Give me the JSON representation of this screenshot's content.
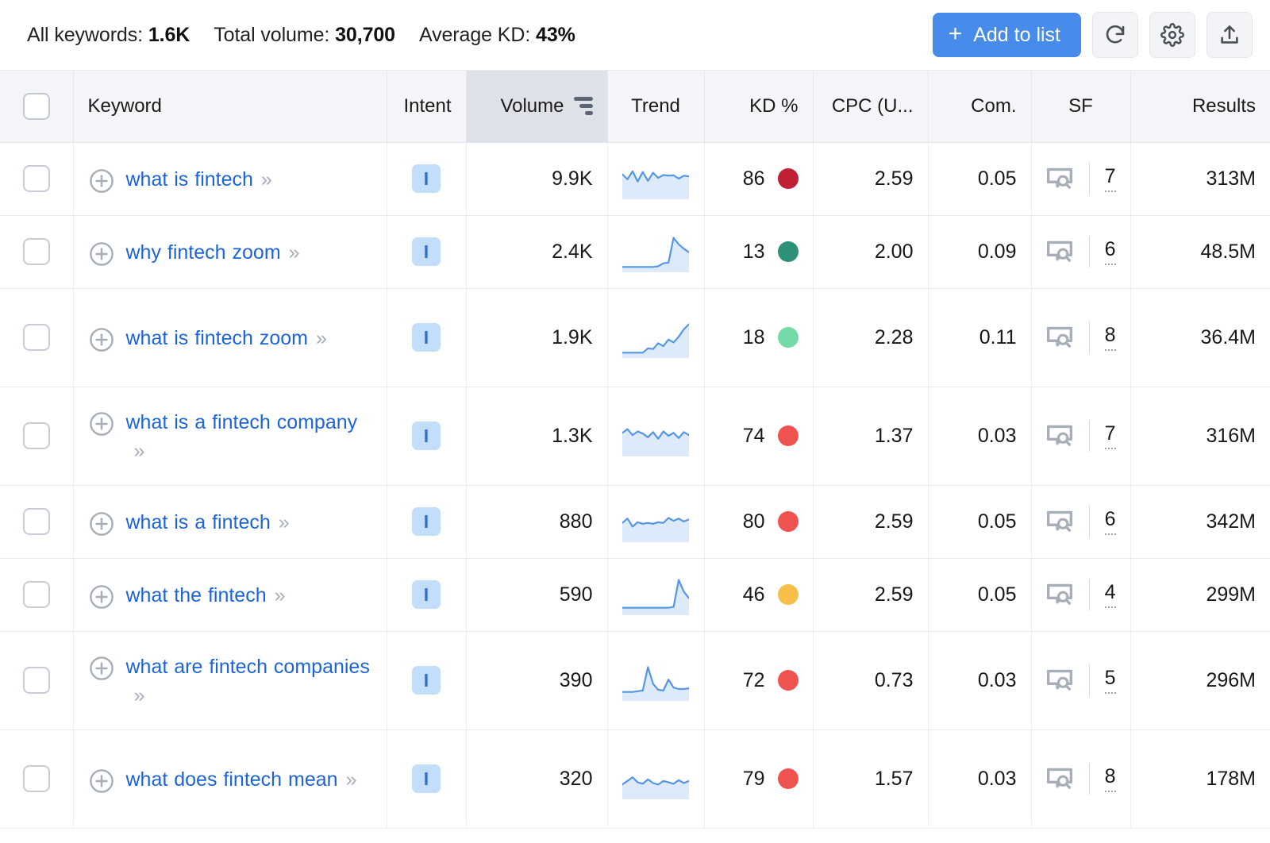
{
  "toolbar": {
    "stats": [
      {
        "label": "All keywords:",
        "value": "1.6K"
      },
      {
        "label": "Total volume:",
        "value": "30,700"
      },
      {
        "label": "Average KD:",
        "value": "43%"
      }
    ],
    "add_to_list_label": "Add to list",
    "plus_glyph": "+",
    "refresh_title": "refresh",
    "settings_title": "settings",
    "export_title": "export"
  },
  "colors": {
    "accent": "#478ceb",
    "link": "#1d64d8",
    "header_bg": "#f4f5f8",
    "sorted_header_bg": "#dfe1e9",
    "intent_badge_bg": "#c3defa",
    "intent_badge_fg": "#2b6fd1",
    "spark_line": "#5596e6",
    "spark_fill": "#dceafa",
    "kd_dark_red": "#bf2033",
    "kd_red": "#ef5350",
    "kd_amber": "#f5bf4a",
    "kd_green": "#2e9077",
    "kd_light_green": "#74dba8"
  },
  "table": {
    "columns": [
      {
        "key": "checkbox",
        "label": "",
        "align": "center"
      },
      {
        "key": "keyword",
        "label": "Keyword",
        "align": "left"
      },
      {
        "key": "intent",
        "label": "Intent",
        "align": "right"
      },
      {
        "key": "volume",
        "label": "Volume",
        "align": "right",
        "sorted": true,
        "sort_icon": "sort-desc-icon"
      },
      {
        "key": "trend",
        "label": "Trend",
        "align": "center"
      },
      {
        "key": "kd",
        "label": "KD %",
        "align": "right"
      },
      {
        "key": "cpc",
        "label": "CPC (U...",
        "align": "right"
      },
      {
        "key": "com",
        "label": "Com.",
        "align": "right"
      },
      {
        "key": "sf",
        "label": "SF",
        "align": "center"
      },
      {
        "key": "results",
        "label": "Results",
        "align": "right"
      }
    ],
    "chevron": "»",
    "rows": [
      {
        "keyword": "what is fintech",
        "intent": "I",
        "volume": "9.9K",
        "kd": "86",
        "kd_color": "#bf2033",
        "cpc": "2.59",
        "com": "0.05",
        "sf": "7",
        "results": "313M",
        "trend": [
          62,
          48,
          70,
          42,
          68,
          44,
          66,
          52,
          60,
          58,
          59,
          50,
          58,
          56
        ],
        "tall": false
      },
      {
        "keyword": "why fintech zoom",
        "intent": "I",
        "volume": "2.4K",
        "kd": "13",
        "kd_color": "#2e9077",
        "cpc": "2.00",
        "com": "0.09",
        "sf": "6",
        "results": "48.5M",
        "trend": [
          8,
          8,
          8,
          8,
          8,
          8,
          8,
          10,
          18,
          20,
          88,
          70,
          58,
          48
        ],
        "tall": false
      },
      {
        "keyword": "what is fintech zoom",
        "intent": "I",
        "volume": "1.9K",
        "kd": "18",
        "kd_color": "#74dba8",
        "cpc": "2.28",
        "com": "0.11",
        "sf": "8",
        "results": "36.4M",
        "trend": [
          8,
          8,
          8,
          8,
          8,
          20,
          18,
          34,
          26,
          44,
          36,
          52,
          72,
          86
        ],
        "tall": true
      },
      {
        "keyword": "what is a fintech company",
        "intent": "I",
        "volume": "1.3K",
        "kd": "74",
        "kd_color": "#ef5350",
        "cpc": "1.37",
        "com": "0.03",
        "sf": "7",
        "results": "316M",
        "trend": [
          58,
          68,
          52,
          62,
          56,
          46,
          60,
          42,
          62,
          50,
          58,
          44,
          60,
          52
        ],
        "tall": true
      },
      {
        "keyword": "what is a fintech",
        "intent": "I",
        "volume": "880",
        "kd": "80",
        "kd_color": "#ef5350",
        "cpc": "2.59",
        "com": "0.05",
        "sf": "6",
        "results": "342M",
        "trend": [
          46,
          58,
          36,
          48,
          44,
          46,
          44,
          48,
          46,
          60,
          52,
          58,
          50,
          56
        ],
        "tall": false
      },
      {
        "keyword": "what the fintech",
        "intent": "I",
        "volume": "590",
        "kd": "46",
        "kd_color": "#f5bf4a",
        "cpc": "2.59",
        "com": "0.05",
        "sf": "4",
        "results": "299M",
        "trend": [
          14,
          14,
          14,
          14,
          14,
          14,
          14,
          14,
          14,
          14,
          16,
          90,
          58,
          40
        ],
        "tall": false
      },
      {
        "keyword": "what are fintech companies",
        "intent": "I",
        "volume": "390",
        "kd": "72",
        "kd_color": "#ef5350",
        "cpc": "0.73",
        "com": "0.03",
        "sf": "5",
        "results": "296M",
        "trend": [
          18,
          18,
          18,
          20,
          22,
          86,
          40,
          24,
          22,
          52,
          30,
          26,
          26,
          28
        ],
        "tall": true
      },
      {
        "keyword": "what does fintech mean",
        "intent": "I",
        "volume": "320",
        "kd": "79",
        "kd_color": "#ef5350",
        "cpc": "1.57",
        "com": "0.03",
        "sf": "8",
        "results": "178M",
        "trend": [
          34,
          44,
          54,
          40,
          36,
          48,
          38,
          34,
          44,
          40,
          36,
          46,
          38,
          44
        ],
        "tall": true
      }
    ]
  }
}
